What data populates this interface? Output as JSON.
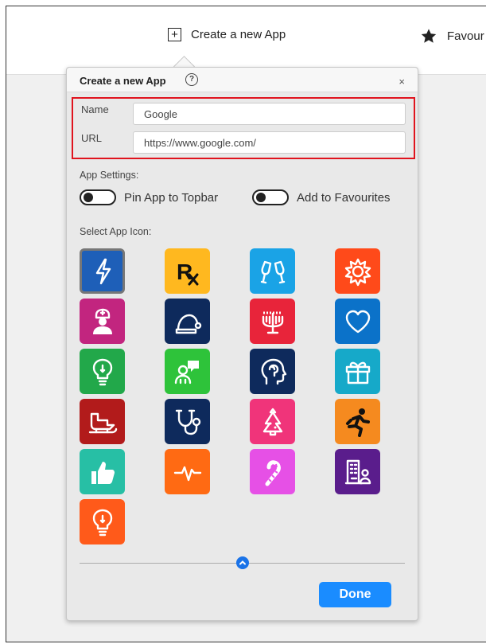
{
  "topbar": {
    "create_label": "Create a new App",
    "favourites_label": "Favour"
  },
  "popup": {
    "title": "Create a new App",
    "help_glyph": "?",
    "close_glyph": "×",
    "name_label": "Name",
    "name_value": "Google",
    "url_label": "URL",
    "url_value": "https://www.google.com/",
    "settings_label": "App Settings:",
    "pin_label": "Pin App to Topbar",
    "pin_enabled": false,
    "fav_label": "Add to Favourites",
    "fav_enabled": false,
    "icon_label": "Select App Icon:",
    "done_label": "Done"
  },
  "icons": [
    {
      "name": "lightning",
      "color": "#1e5fb8",
      "selected": true
    },
    {
      "name": "prescription-rx",
      "color": "#ffb81f"
    },
    {
      "name": "champagne-toast",
      "color": "#1aa3e6"
    },
    {
      "name": "sun-gear",
      "color": "#ff4a1a"
    },
    {
      "name": "nurse",
      "color": "#c2257f"
    },
    {
      "name": "santa-hat",
      "color": "#0e2a5c"
    },
    {
      "name": "menorah",
      "color": "#e8243a"
    },
    {
      "name": "heart",
      "color": "#0b72c9"
    },
    {
      "name": "lightbulb",
      "color": "#22a84a"
    },
    {
      "name": "people-chat",
      "color": "#2ec33a"
    },
    {
      "name": "head-brain",
      "color": "#0e2a5c"
    },
    {
      "name": "gift",
      "color": "#16a9c9"
    },
    {
      "name": "sleigh",
      "color": "#b21b1b"
    },
    {
      "name": "stethoscope",
      "color": "#0e2a5c"
    },
    {
      "name": "christmas-tree",
      "color": "#f0347a"
    },
    {
      "name": "running-man",
      "color": "#f58a1f"
    },
    {
      "name": "thumbs-up",
      "color": "#27bfa5"
    },
    {
      "name": "heartbeat",
      "color": "#ff6a13"
    },
    {
      "name": "candy-cane",
      "color": "#e650e6"
    },
    {
      "name": "building-person",
      "color": "#5a1d8c"
    },
    {
      "name": "lightbulb",
      "color": "#ff5a1a"
    }
  ]
}
